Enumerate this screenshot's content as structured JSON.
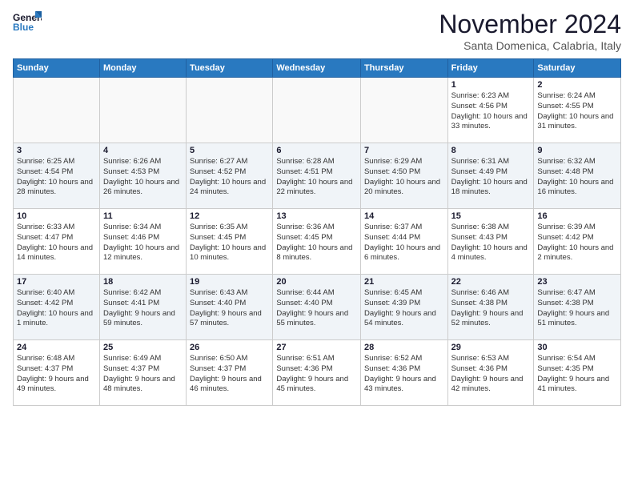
{
  "logo": {
    "line1": "General",
    "line2": "Blue"
  },
  "title": "November 2024",
  "location": "Santa Domenica, Calabria, Italy",
  "days_of_week": [
    "Sunday",
    "Monday",
    "Tuesday",
    "Wednesday",
    "Thursday",
    "Friday",
    "Saturday"
  ],
  "weeks": [
    [
      {
        "day": "",
        "info": ""
      },
      {
        "day": "",
        "info": ""
      },
      {
        "day": "",
        "info": ""
      },
      {
        "day": "",
        "info": ""
      },
      {
        "day": "",
        "info": ""
      },
      {
        "day": "1",
        "info": "Sunrise: 6:23 AM\nSunset: 4:56 PM\nDaylight: 10 hours and 33 minutes."
      },
      {
        "day": "2",
        "info": "Sunrise: 6:24 AM\nSunset: 4:55 PM\nDaylight: 10 hours and 31 minutes."
      }
    ],
    [
      {
        "day": "3",
        "info": "Sunrise: 6:25 AM\nSunset: 4:54 PM\nDaylight: 10 hours and 28 minutes."
      },
      {
        "day": "4",
        "info": "Sunrise: 6:26 AM\nSunset: 4:53 PM\nDaylight: 10 hours and 26 minutes."
      },
      {
        "day": "5",
        "info": "Sunrise: 6:27 AM\nSunset: 4:52 PM\nDaylight: 10 hours and 24 minutes."
      },
      {
        "day": "6",
        "info": "Sunrise: 6:28 AM\nSunset: 4:51 PM\nDaylight: 10 hours and 22 minutes."
      },
      {
        "day": "7",
        "info": "Sunrise: 6:29 AM\nSunset: 4:50 PM\nDaylight: 10 hours and 20 minutes."
      },
      {
        "day": "8",
        "info": "Sunrise: 6:31 AM\nSunset: 4:49 PM\nDaylight: 10 hours and 18 minutes."
      },
      {
        "day": "9",
        "info": "Sunrise: 6:32 AM\nSunset: 4:48 PM\nDaylight: 10 hours and 16 minutes."
      }
    ],
    [
      {
        "day": "10",
        "info": "Sunrise: 6:33 AM\nSunset: 4:47 PM\nDaylight: 10 hours and 14 minutes."
      },
      {
        "day": "11",
        "info": "Sunrise: 6:34 AM\nSunset: 4:46 PM\nDaylight: 10 hours and 12 minutes."
      },
      {
        "day": "12",
        "info": "Sunrise: 6:35 AM\nSunset: 4:45 PM\nDaylight: 10 hours and 10 minutes."
      },
      {
        "day": "13",
        "info": "Sunrise: 6:36 AM\nSunset: 4:45 PM\nDaylight: 10 hours and 8 minutes."
      },
      {
        "day": "14",
        "info": "Sunrise: 6:37 AM\nSunset: 4:44 PM\nDaylight: 10 hours and 6 minutes."
      },
      {
        "day": "15",
        "info": "Sunrise: 6:38 AM\nSunset: 4:43 PM\nDaylight: 10 hours and 4 minutes."
      },
      {
        "day": "16",
        "info": "Sunrise: 6:39 AM\nSunset: 4:42 PM\nDaylight: 10 hours and 2 minutes."
      }
    ],
    [
      {
        "day": "17",
        "info": "Sunrise: 6:40 AM\nSunset: 4:42 PM\nDaylight: 10 hours and 1 minute."
      },
      {
        "day": "18",
        "info": "Sunrise: 6:42 AM\nSunset: 4:41 PM\nDaylight: 9 hours and 59 minutes."
      },
      {
        "day": "19",
        "info": "Sunrise: 6:43 AM\nSunset: 4:40 PM\nDaylight: 9 hours and 57 minutes."
      },
      {
        "day": "20",
        "info": "Sunrise: 6:44 AM\nSunset: 4:40 PM\nDaylight: 9 hours and 55 minutes."
      },
      {
        "day": "21",
        "info": "Sunrise: 6:45 AM\nSunset: 4:39 PM\nDaylight: 9 hours and 54 minutes."
      },
      {
        "day": "22",
        "info": "Sunrise: 6:46 AM\nSunset: 4:38 PM\nDaylight: 9 hours and 52 minutes."
      },
      {
        "day": "23",
        "info": "Sunrise: 6:47 AM\nSunset: 4:38 PM\nDaylight: 9 hours and 51 minutes."
      }
    ],
    [
      {
        "day": "24",
        "info": "Sunrise: 6:48 AM\nSunset: 4:37 PM\nDaylight: 9 hours and 49 minutes."
      },
      {
        "day": "25",
        "info": "Sunrise: 6:49 AM\nSunset: 4:37 PM\nDaylight: 9 hours and 48 minutes."
      },
      {
        "day": "26",
        "info": "Sunrise: 6:50 AM\nSunset: 4:37 PM\nDaylight: 9 hours and 46 minutes."
      },
      {
        "day": "27",
        "info": "Sunrise: 6:51 AM\nSunset: 4:36 PM\nDaylight: 9 hours and 45 minutes."
      },
      {
        "day": "28",
        "info": "Sunrise: 6:52 AM\nSunset: 4:36 PM\nDaylight: 9 hours and 43 minutes."
      },
      {
        "day": "29",
        "info": "Sunrise: 6:53 AM\nSunset: 4:36 PM\nDaylight: 9 hours and 42 minutes."
      },
      {
        "day": "30",
        "info": "Sunrise: 6:54 AM\nSunset: 4:35 PM\nDaylight: 9 hours and 41 minutes."
      }
    ]
  ]
}
